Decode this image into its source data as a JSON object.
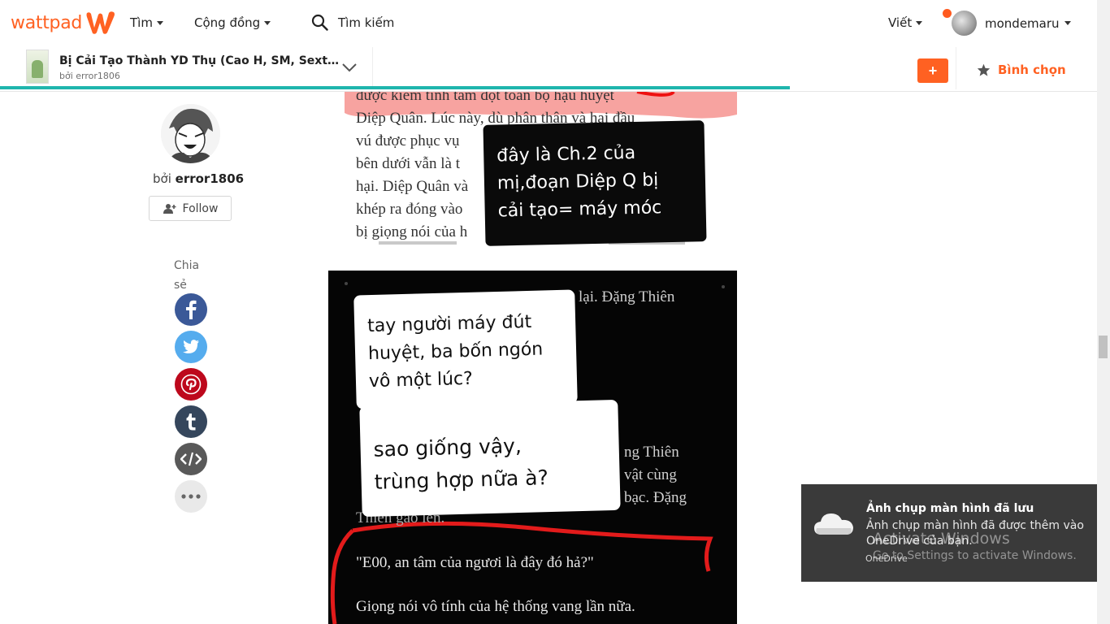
{
  "brand": {
    "name": "wattpad",
    "color": "#ff6122"
  },
  "nav": {
    "browse": "Tìm",
    "community": "Cộng đồng",
    "search_label": "Tìm kiếm",
    "write": "Viết",
    "username": "mondemaru"
  },
  "story": {
    "title": "Bị Cải Tạo Thành YD Thụ (Cao H, SM, Sextoys)_e...",
    "author_line": "bởi error1806",
    "add_button": "+",
    "vote_label": "Bình chọn",
    "progress": 0.72,
    "progress_color": "#1fb5ad"
  },
  "author": {
    "by": "bởi",
    "name": "error1806",
    "follow_label": "Follow"
  },
  "share": {
    "label": "Chia sẻ",
    "items": [
      "facebook-icon",
      "twitter-icon",
      "pinterest-icon",
      "tumblr-icon",
      "embed-icon",
      "more-icon"
    ]
  },
  "image1": {
    "text_lines": [
      "được kiếm tính tâm đột toàn bộ hạu huyệt",
      "Diệp Quân. Lúc này, dù phân thân và hai đầu",
      "vú được phục vụ",
      "bên dưới vẫn là t",
      "hại. Diệp Quân và",
      "khép ra đóng vào",
      "bị giọng nói của h"
    ],
    "annotation_lines": [
      "đây là Ch.2 của",
      "mị,đoạn Diệp Q bị",
      "cải tạo= máy móc"
    ]
  },
  "image2": {
    "bubble1_lines": [
      "tay người máy đút",
      "huyệt, ba bốn ngón",
      "vô một lúc?"
    ],
    "bubble2_lines": [
      "sao giống vậy,",
      "trùng hợp nữa à?"
    ],
    "bg_top": "lại. Đặng Thiên",
    "bg_lines": [
      "ng Thiên",
      "vật cùng",
      "bạc. Đặng",
      "Thiên gào lên."
    ],
    "quote": "\"E00, an tâm của ngươi là đây đó hả?\"",
    "last": "Giọng nói vô tính của hệ thống vang lần nữa."
  },
  "toast": {
    "title": "Ảnh chụp màn hình đã lưu",
    "body": "Ảnh chụp màn hình đã được thêm vào OneDrive của bạn.",
    "app": "OneDrive"
  },
  "watermark": {
    "line1": "Activate Windows",
    "line2": "Go to Settings to activate Windows."
  }
}
